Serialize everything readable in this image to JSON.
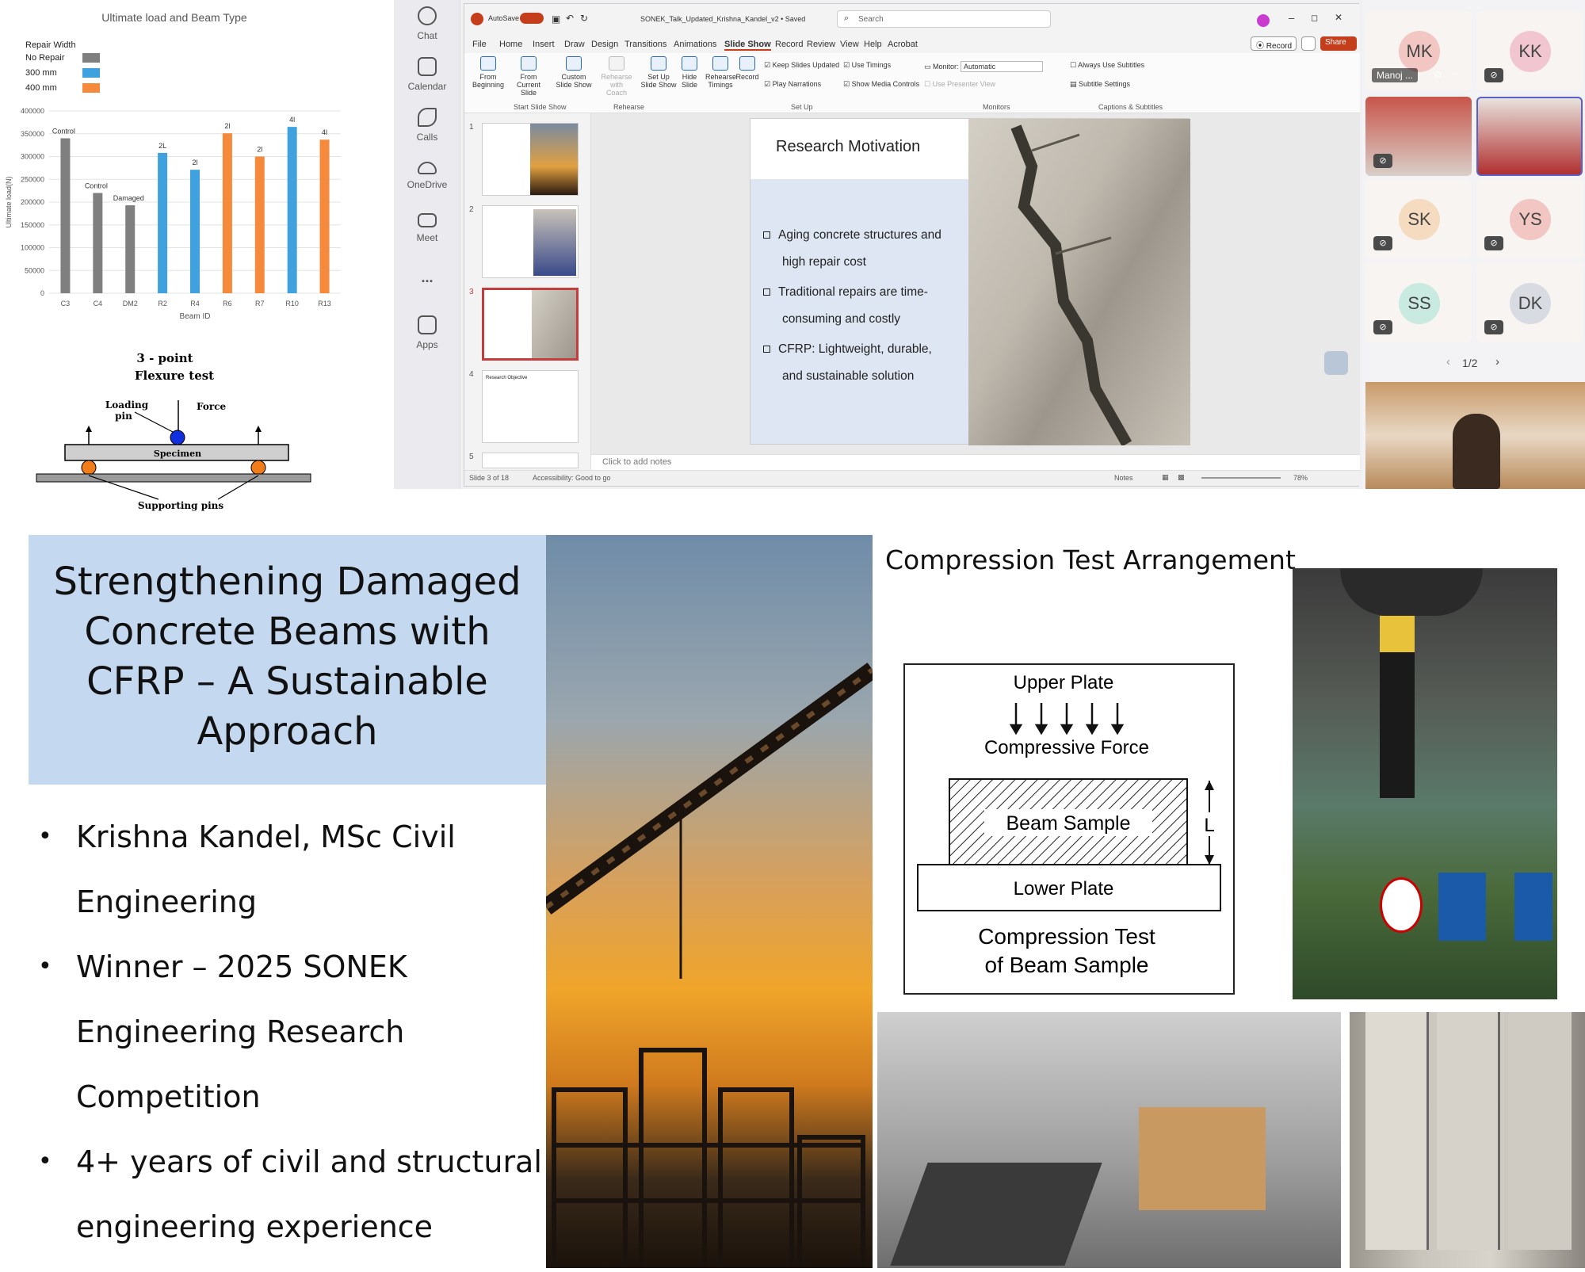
{
  "bar_chart": {
    "chart_data": {
      "type": "bar",
      "title": "Ultimate load and Beam Type",
      "xlabel": "Beam ID",
      "ylabel": "Ultimate load(N)",
      "ylim": [
        0,
        400000
      ],
      "yticks": [
        "0",
        "50000",
        "100000",
        "150000",
        "200000",
        "250000",
        "300000",
        "350000",
        "400000"
      ],
      "legend_title": "Repair Width",
      "legend": [
        {
          "name": "No Repair",
          "color": "#7f7f7f"
        },
        {
          "name": "300 mm",
          "color": "#3fa1dd"
        },
        {
          "name": "400 mm",
          "color": "#f58a3c"
        }
      ],
      "categories": [
        "C3",
        "C4",
        "DM2",
        "R2",
        "R4",
        "R6",
        "R7",
        "R10",
        "R13"
      ],
      "values": [
        340000,
        220000,
        193000,
        308000,
        271000,
        351000,
        300000,
        365000,
        337000
      ],
      "groups": [
        "No Repair",
        "No Repair",
        "No Repair",
        "300 mm",
        "300 mm",
        "400 mm",
        "400 mm",
        "300 mm",
        "400 mm"
      ],
      "bar_labels": [
        "Control",
        "Control",
        "Damaged",
        "2L",
        "2l",
        "2l",
        "2l",
        "4l",
        "4l"
      ]
    }
  },
  "flexure": {
    "title_line1": "3 - point",
    "title_line2": "Flexure test",
    "loading_pin": "Loading",
    "loading_pin2": "pin",
    "force": "Force",
    "specimen": "Specimen",
    "supporting_pins": "Supporting pins"
  },
  "teams_rail": [
    {
      "label": "Chat",
      "icon": "chat-icon"
    },
    {
      "label": "Calendar",
      "icon": "calendar-icon"
    },
    {
      "label": "Calls",
      "icon": "phone-icon"
    },
    {
      "label": "OneDrive",
      "icon": "cloud-icon"
    },
    {
      "label": "Meet",
      "icon": "video-icon"
    },
    {
      "label": "...",
      "icon": "more-icon"
    },
    {
      "label": "Apps",
      "icon": "apps-icon"
    }
  ],
  "ppt": {
    "autosave": "AutoSave",
    "doc_title": "SONEK_Talk_Updated_Krishna_Kandel_v2 • Saved",
    "search_placeholder": "Search",
    "record_btn": "Record",
    "share_btn": "Share",
    "tabs": [
      "File",
      "Home",
      "Insert",
      "Draw",
      "Design",
      "Transitions",
      "Animations",
      "Slide Show",
      "Record",
      "Review",
      "View",
      "Help",
      "Acrobat"
    ],
    "active_tab": "Slide Show",
    "ribbon": {
      "from_beginning": "From Beginning",
      "from_current": "From Current Slide",
      "custom_show": "Custom Slide Show",
      "rehearse_coach": "Rehearse with Coach",
      "setup_show": "Set Up Slide Show",
      "hide_slide": "Hide Slide",
      "rehearse_timings": "Rehearse Timings",
      "record": "Record",
      "keep_updated": "Keep Slides Updated",
      "play_narrations": "Play Narrations",
      "use_timings": "Use Timings",
      "show_media": "Show Media Controls",
      "monitor_label": "Monitor:",
      "monitor_value": "Automatic",
      "presenter_view": "Use Presenter View",
      "always_subtitles": "Always Use Subtitles",
      "subtitle_settings": "Subtitle Settings",
      "grp_start": "Start Slide Show",
      "grp_rehearse": "Rehearse",
      "grp_setup": "Set Up",
      "grp_monitors": "Monitors",
      "grp_captions": "Captions & Subtitles"
    },
    "slide": {
      "title": "Research Motivation",
      "bullets": [
        "Aging concrete structures and",
        "high repair cost",
        "Traditional repairs are time-",
        "consuming and costly",
        "CFRP: Lightweight, durable,",
        "and sustainable solution"
      ]
    },
    "notes_placeholder": "Click to add notes",
    "status": {
      "slide_of": "Slide 3 of 18",
      "accessibility": "Accessibility: Good to go",
      "notes": "Notes",
      "zoom": "78%"
    },
    "thumb_numbers": [
      "1",
      "2",
      "3",
      "4",
      "5"
    ],
    "thumb4_title": "Research Objective"
  },
  "participants": {
    "tiles": [
      {
        "initials": "MK",
        "name": "Manoj ...",
        "color": "#f2c6c2"
      },
      {
        "initials": "KK",
        "name": "",
        "color": "#f2c6d0"
      },
      {
        "initials": "SK",
        "name": "",
        "color": "#f5dcc0"
      },
      {
        "initials": "YS",
        "name": "",
        "color": "#f2c6c2"
      },
      {
        "initials": "SS",
        "name": "",
        "color": "#c8eae0"
      },
      {
        "initials": "DK",
        "name": "",
        "color": "#d8dce2"
      }
    ],
    "page": "1/2"
  },
  "title_slide": {
    "title_lines": [
      "Strengthening Damaged",
      "Concrete Beams with",
      "CFRP – A Sustainable",
      "Approach"
    ],
    "bullets": [
      [
        "Krishna Kandel, MSc Civil",
        "Engineering"
      ],
      [
        "Winner – 2025 SONEK",
        "Engineering Research",
        "Competition"
      ],
      [
        "4+ years of civil and structural",
        "engineering experience"
      ]
    ]
  },
  "compression_slide": {
    "title": "Compression Test Arrangement",
    "upper_plate": "Upper Plate",
    "compressive_force": "Compressive Force",
    "beam_sample": "Beam Sample",
    "l_label": "L",
    "lower_plate": "Lower Plate",
    "caption_line1": "Compression Test",
    "caption_line2": "of Beam Sample"
  }
}
